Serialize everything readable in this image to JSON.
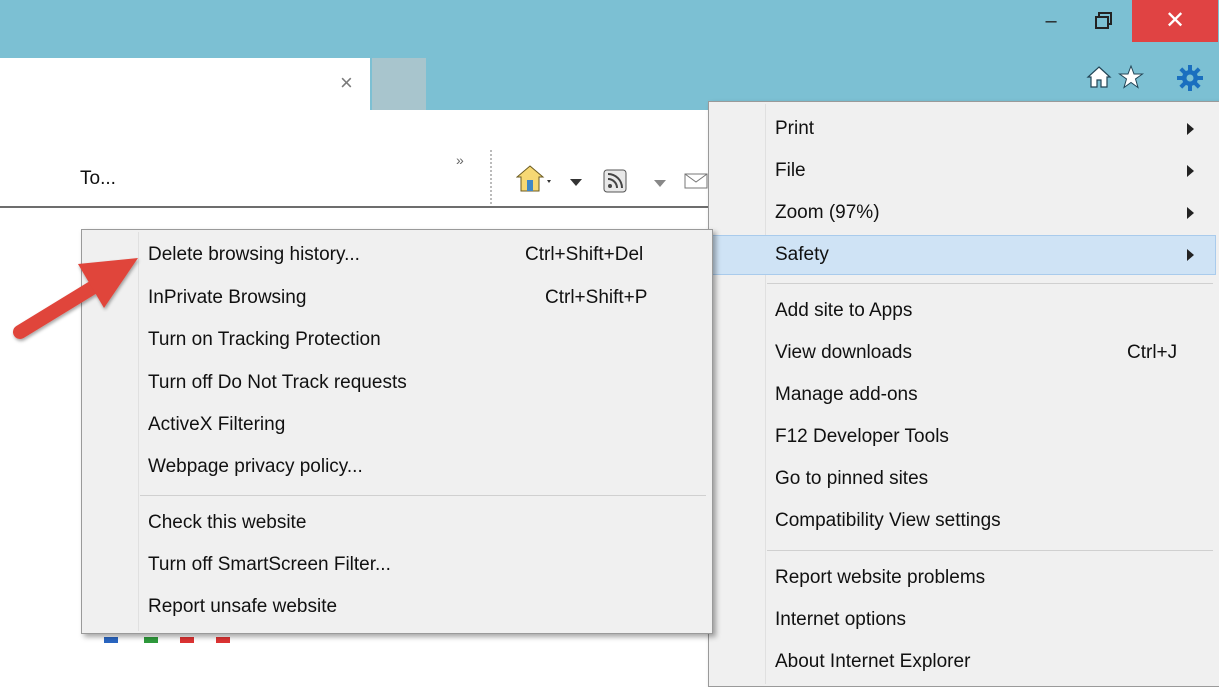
{
  "window": {
    "close_glyph": "✕",
    "minimize_glyph": "–"
  },
  "tab": {
    "close_glyph": "×"
  },
  "command_bar": {
    "text": "To...",
    "chevron": "»"
  },
  "tools_menu": {
    "items": [
      {
        "label": "Print",
        "submenu": true
      },
      {
        "label": "File",
        "submenu": true
      },
      {
        "label": "Zoom (97%)",
        "submenu": true
      },
      {
        "label": "Safety",
        "submenu": true,
        "highlighted": true
      },
      {
        "label": "Add site to Apps"
      },
      {
        "label": "View downloads",
        "shortcut": "Ctrl+J"
      },
      {
        "label": "Manage add-ons"
      },
      {
        "label": "F12 Developer Tools"
      },
      {
        "label": "Go to pinned sites"
      },
      {
        "label": "Compatibility View settings"
      },
      {
        "label": "Report website problems"
      },
      {
        "label": "Internet options"
      },
      {
        "label": "About Internet Explorer"
      }
    ]
  },
  "safety_menu": {
    "items": [
      {
        "label": "Delete browsing history...",
        "shortcut": "Ctrl+Shift+Del"
      },
      {
        "label": "InPrivate Browsing",
        "shortcut": "Ctrl+Shift+P"
      },
      {
        "label": "Turn on Tracking Protection"
      },
      {
        "label": "Turn off Do Not Track requests"
      },
      {
        "label": "ActiveX Filtering"
      },
      {
        "label": "Webpage privacy policy..."
      },
      {
        "label": "Check this website"
      },
      {
        "label": "Turn off SmartScreen Filter..."
      },
      {
        "label": "Report unsafe website"
      }
    ]
  },
  "colors": {
    "titlebar": "#7cc0d3",
    "close": "#e04343",
    "highlight": "#cfe3f5",
    "arrow": "#e0443a"
  }
}
